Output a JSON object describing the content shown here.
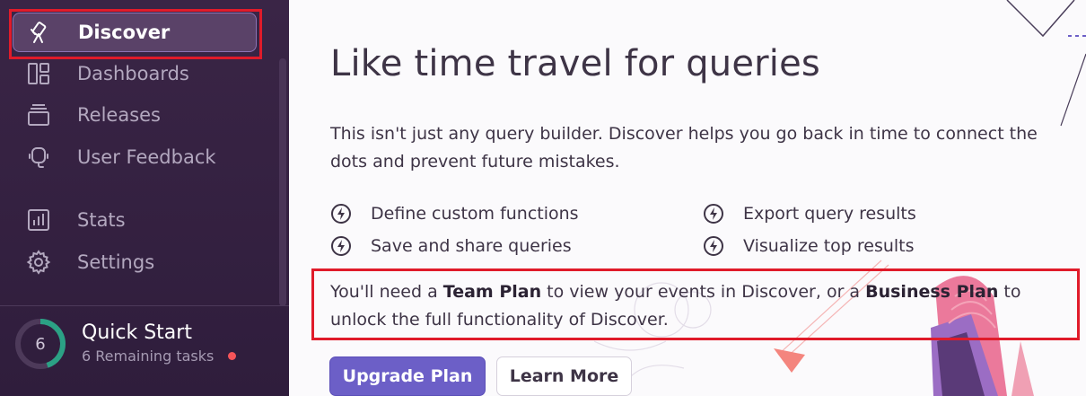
{
  "sidebar": {
    "items": [
      {
        "label": "Discover",
        "icon": "telescope-icon",
        "active": true
      },
      {
        "label": "Dashboards",
        "icon": "dashboard-icon",
        "active": false
      },
      {
        "label": "Releases",
        "icon": "releases-icon",
        "active": false
      },
      {
        "label": "User Feedback",
        "icon": "feedback-icon",
        "active": false
      },
      {
        "label": "Stats",
        "icon": "stats-icon",
        "active": false
      },
      {
        "label": "Settings",
        "icon": "settings-icon",
        "active": false
      }
    ],
    "quick_start": {
      "title": "Quick Start",
      "count": "6",
      "subtitle": "6 Remaining tasks",
      "progress": 0.45
    }
  },
  "main": {
    "title": "Like time travel for queries",
    "description": "This isn't just any query builder. Discover helps you go back in time to connect the dots and prevent future mistakes.",
    "features": [
      "Define custom functions",
      "Export query results",
      "Save and share queries",
      "Visualize top results"
    ],
    "notice": {
      "prefix": "You'll need a ",
      "team_plan": "Team Plan",
      "middle": " to view your events in Discover, or a ",
      "business_plan": "Business Plan",
      "suffix": " to unlock the full functionality of Discover."
    },
    "buttons": {
      "upgrade": "Upgrade Plan",
      "learn_more": "Learn More"
    }
  },
  "colors": {
    "sidebar_bg": "#3a2546",
    "accent": "#6c5fc7",
    "highlight": "#e01b2a",
    "notification_dot": "#f55459",
    "progress_ring": "#2ba185"
  }
}
